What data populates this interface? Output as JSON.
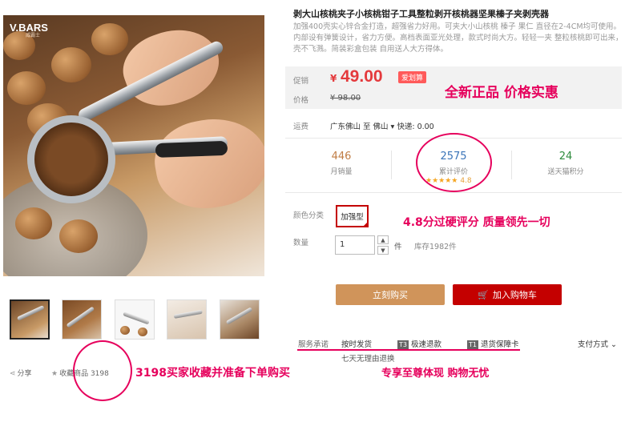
{
  "gallery": {
    "logo": "V.BARS",
    "logo_sub": "威霸士",
    "thumb_count": 5
  },
  "product": {
    "title": "剥大山核桃夹子小核桃钳子工具整粒剥开核桃器坚果榛子夹剥壳器",
    "subtitle": "加强400壳实心锌合金打造，超强省力好用。可夹大小山核桃 榛子 果仁 直径在2-4CM均可使用。内部设有弹簧设计，省力方便。高档表面亚光处理，款式时尚大方。轻轻一夹 整粒核桃即可出来，壳不飞溅。简装彩盒包装 自用送人大方得体。"
  },
  "price": {
    "promo_label": "促销",
    "currency": "¥",
    "value": "49.00",
    "badge": "爱划算",
    "orig_label": "价格",
    "orig": "¥ 98.00",
    "annotation": "全新正品  价格实惠"
  },
  "shipping": {
    "label": "运费",
    "text": "广东佛山  至  佛山 ▾  快递: 0.00"
  },
  "stats": {
    "sales_num": "446",
    "sales_label": "月销量",
    "reviews_num": "2575",
    "reviews_label": "累计评价",
    "stars": "★★★★★",
    "rating": "4.8",
    "points_num": "24",
    "points_label": "送天猫积分",
    "annotation": "4.8分过硬评分 质量领先一切"
  },
  "options": {
    "color_label": "颜色分类",
    "color_value": "加强型",
    "qty_label": "数量",
    "qty_value": "1",
    "unit": "件",
    "stock": "库存1982件",
    "up": "▲",
    "down": "▼"
  },
  "actions": {
    "buy": "立刻购买",
    "cart": "加入购物车",
    "cart_icon": "cart-icon"
  },
  "service": {
    "label": "服务承诺",
    "item1": "按时发货",
    "item2_tag": "T3",
    "item2": "极速退款",
    "item3_tag": "T1",
    "item3": "退货保障卡",
    "payment": "支付方式 ⌄",
    "sub": "七天无理由退换",
    "annotation": "专享至尊体现 购物无忧"
  },
  "social": {
    "share": "分享",
    "fav": "收藏商品 3198",
    "annotation": "3198买家收藏并准备下单购买"
  },
  "colors": {
    "red": "#c40000",
    "price": "#e4393c",
    "annotation": "#e6005c",
    "buy": "#d0945a"
  }
}
